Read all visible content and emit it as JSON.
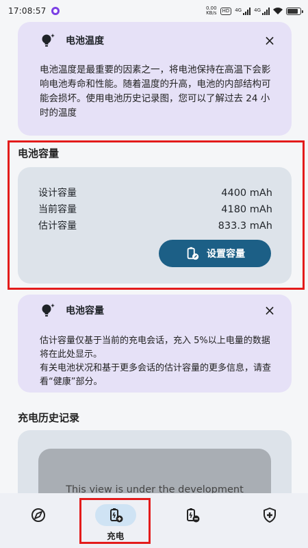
{
  "status_bar": {
    "time": "17:08:57",
    "net_speed_value": "0.00",
    "net_speed_unit": "KB/s",
    "hd_badge": "HD",
    "sim1_label": "4G",
    "sim2_label": "4G"
  },
  "temp_card": {
    "title": "电池温度",
    "close_label": "×",
    "body": "电池温度是最重要的因素之一，将电池保持在高温下会影响电池寿命和性能。随着温度的升高，电池的内部结构可能会损坏。使用电池历史记录图，您可以了解过去 24 小时的温度"
  },
  "capacity_section": {
    "title": "电池容量",
    "rows": [
      {
        "label": "设计容量",
        "value": "4400 mAh"
      },
      {
        "label": "当前容量",
        "value": "4180 mAh"
      },
      {
        "label": "估计容量",
        "value": "833.3 mAh"
      }
    ],
    "set_button_label": "设置容量"
  },
  "capacity_info_card": {
    "title": "电池容量",
    "close_label": "×",
    "body_line1": "估计容量仅基于当前的充电会话，充入 5%以上电量的数据将在此处显示。",
    "body_line2": "有关电池状况和基于更多会话的估计容量的更多信息，请查看“健康”部分。"
  },
  "history_section": {
    "title": "充电历史记录",
    "placeholder": "This view is under the development"
  },
  "bottom_nav": {
    "items": [
      {
        "name": "discharge",
        "label": "",
        "icon": "compass-icon"
      },
      {
        "name": "charge",
        "label": "充电",
        "icon": "battery-plus-icon",
        "active": true
      },
      {
        "name": "discharge-tab",
        "label": "",
        "icon": "battery-minus-icon"
      },
      {
        "name": "health",
        "label": "",
        "icon": "shield-plus-icon"
      }
    ]
  },
  "colors": {
    "info_card_bg": "#e6e1f7",
    "capacity_card_bg": "#dde3ea",
    "button_bg": "#1c5f86",
    "highlight_frame": "#e31b1b",
    "nav_active_pill": "#cfe3f4"
  }
}
